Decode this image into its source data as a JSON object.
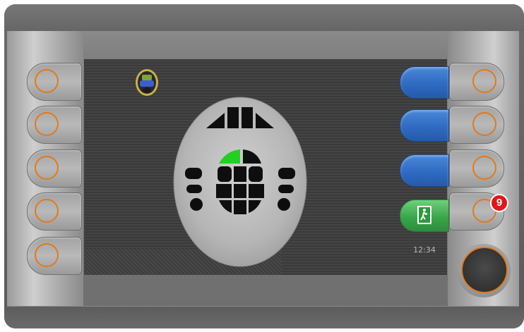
{
  "status": {
    "clock": "12:34"
  },
  "callout": {
    "number": "9"
  },
  "left_softkeys": [
    "softkey-1",
    "softkey-2",
    "softkey-3",
    "softkey-4",
    "softkey-5"
  ],
  "right_softkeys": [
    "softkey-6",
    "softkey-7",
    "softkey-8",
    "softkey-9"
  ],
  "side_buttons": [
    "blue-button-1",
    "blue-button-2",
    "blue-button-3"
  ],
  "exit_button": {
    "icon": "emergency-exit-icon"
  },
  "diagram": {
    "icon": "seat-layout-icon",
    "highlighted_zone": "front-left-center",
    "highlight_color": "#22d022"
  },
  "colors": {
    "accent_ring": "#e07a1e",
    "side_button": "#2f6bc2",
    "exit_button": "#3aa64b",
    "callout": "#e3171b"
  }
}
